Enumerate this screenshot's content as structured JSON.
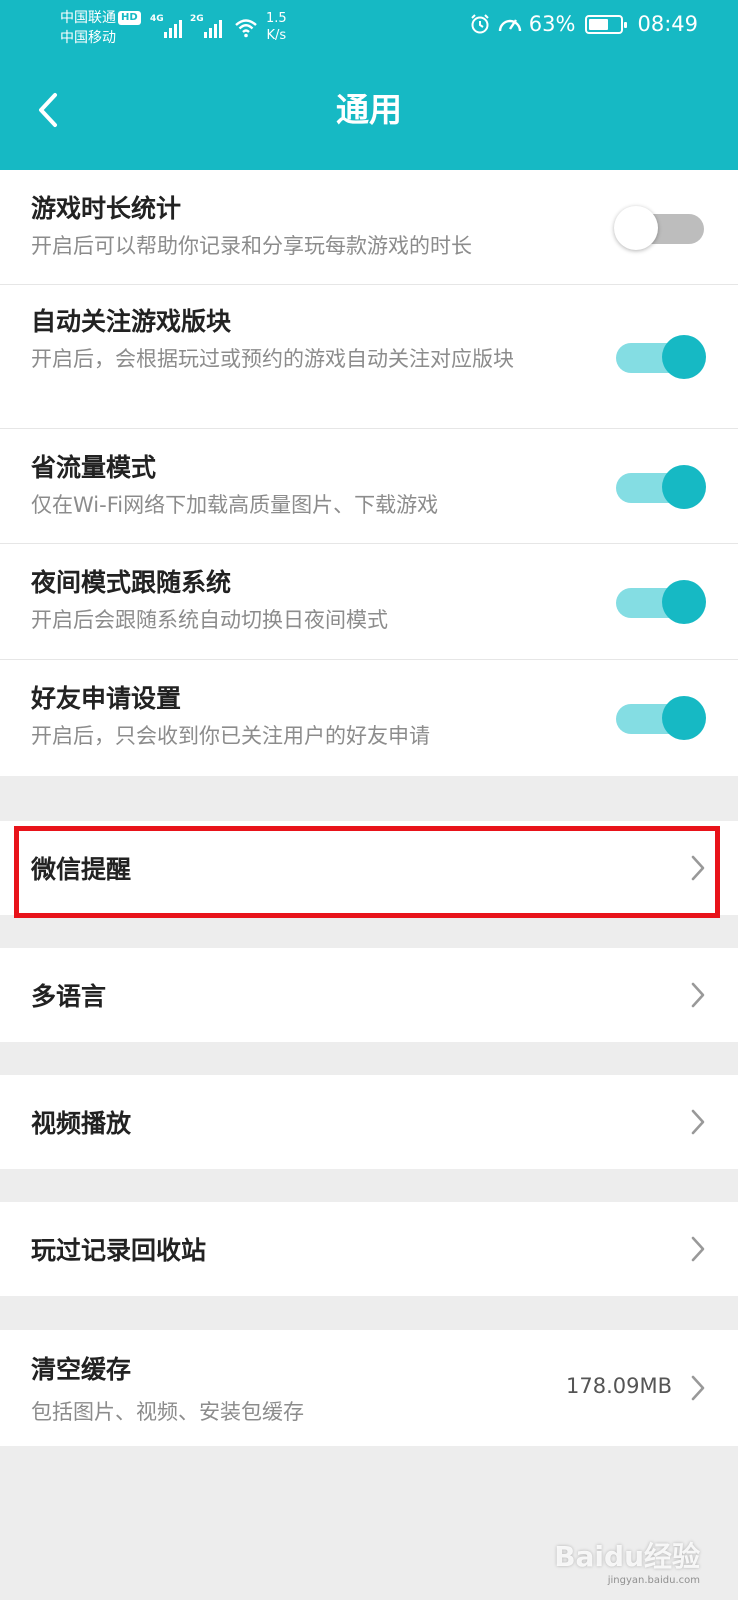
{
  "status_bar": {
    "carrier_1": "中国联通",
    "hd_badge": "HD",
    "carrier_2": "中国移动",
    "net_1": "4G",
    "net_2": "2G",
    "speed_value": "1.5",
    "speed_unit": "K/s",
    "battery_percent": "63%",
    "battery_level": 0.63,
    "time": "08:49"
  },
  "header": {
    "title": "通用",
    "back_icon": "chevron-left-icon",
    "background_color": "#16b9c4"
  },
  "toggles": [
    {
      "title": "游戏时长统计",
      "desc": "开启后可以帮助你记录和分享玩每款游戏的时长",
      "on": false
    },
    {
      "title": "自动关注游戏版块",
      "desc": "开启后，会根据玩过或预约的游戏自动关注对应版块",
      "on": true
    },
    {
      "title": "省流量模式",
      "desc": "仅在Wi-Fi网络下加载高质量图片、下载游戏",
      "on": true
    },
    {
      "title": "夜间模式跟随系统",
      "desc": "开启后会跟随系统自动切换日夜间模式",
      "on": true
    },
    {
      "title": "好友申请设置",
      "desc": "开启后，只会收到你已关注用户的好友申请",
      "on": true
    }
  ],
  "nav_items": [
    {
      "title": "微信提醒",
      "highlighted": true
    },
    {
      "title": "多语言"
    },
    {
      "title": "视频播放"
    },
    {
      "title": "玩过记录回收站"
    }
  ],
  "cache": {
    "title": "清空缓存",
    "desc": "包括图片、视频、安装包缓存",
    "size": "178.09MB"
  },
  "watermark": {
    "text": "Baidu经验",
    "sub": "jingyan.baidu.com"
  },
  "colors": {
    "accent": "#16b9c4",
    "toggle_track_on": "#84dde3",
    "highlight_border": "#e8131a"
  }
}
